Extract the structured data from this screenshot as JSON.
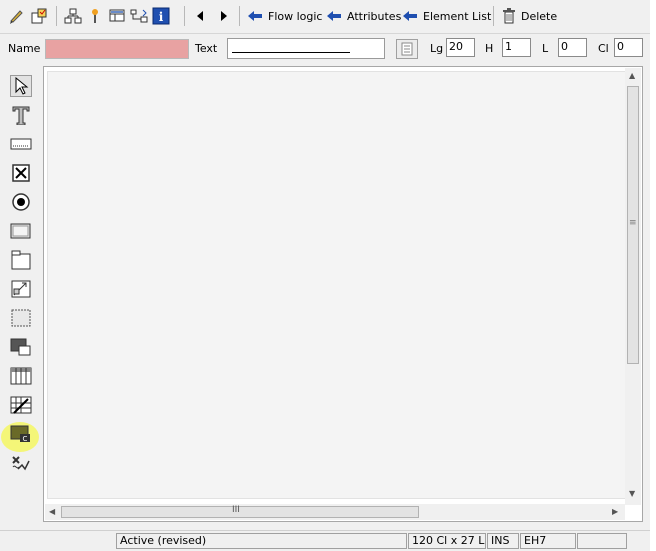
{
  "toolbar": {
    "flow_logic": "Flow logic",
    "attributes": "Attributes",
    "element_list": "Element List",
    "delete": "Delete",
    "icons": [
      "pencil-icon",
      "properties-icon",
      "hierarchy-icon",
      "marker-icon",
      "layout-icon",
      "tree-icon",
      "info-icon",
      "prev-arrow-icon",
      "next-arrow-icon"
    ]
  },
  "attributes_row": {
    "name_label": "Name",
    "name_value": "",
    "text_label": "Text",
    "lg_label": "Lg",
    "lg_value": "20",
    "h_label": "H",
    "h_value": "1",
    "l_label": "L",
    "l_value": "0",
    "cl_label": "Cl",
    "cl_value": "0"
  },
  "palette": {
    "items": [
      "pointer-icon",
      "text-icon",
      "input-field-icon",
      "checkbox-icon",
      "radio-button-icon",
      "pushbutton-icon",
      "box-icon",
      "subscreen-icon",
      "frame-icon",
      "tabstrip-icon",
      "table-control-icon",
      "table-wizard-icon",
      "custom-control-icon",
      "status-icon"
    ],
    "highlighted_item": "custom-control-icon",
    "highlight_color": "#f4f66a"
  },
  "scrollbar": {
    "h_thumb_label": "III",
    "v_thumb_label": "≡"
  },
  "status": {
    "state": "Active (revised)",
    "size": "120 Cl x 27 L",
    "mode": "INS",
    "element": "EH7"
  },
  "colors": {
    "name_field": "#e8a2a2",
    "arrow_blue": "#1f4fb0"
  }
}
